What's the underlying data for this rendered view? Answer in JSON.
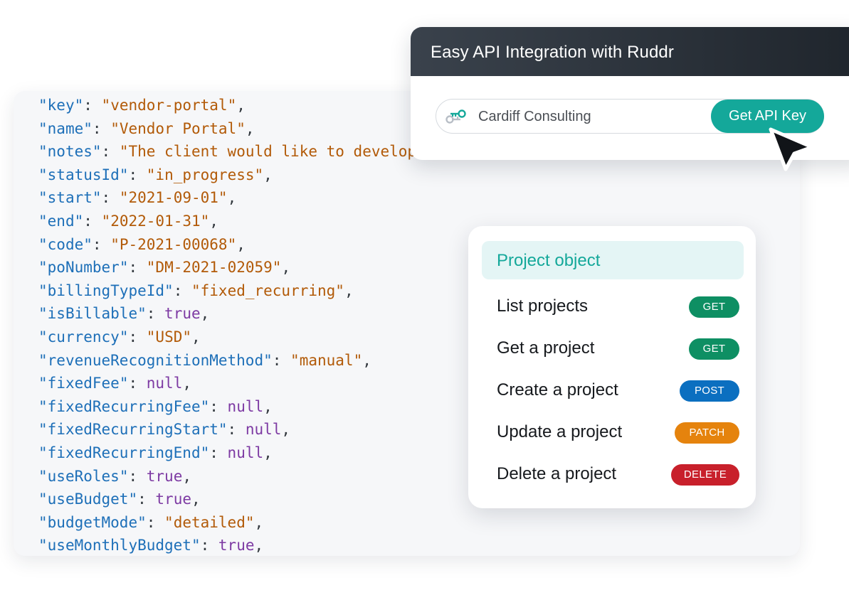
{
  "code": {
    "lines": [
      {
        "key": "key",
        "value": "vendor-portal",
        "type": "string"
      },
      {
        "key": "name",
        "value": "Vendor Portal",
        "type": "string"
      },
      {
        "key": "notes",
        "value": "The client would like to develop",
        "type": "string-open"
      },
      {
        "key": "statusId",
        "value": "in_progress",
        "type": "string"
      },
      {
        "key": "start",
        "value": "2021-09-01",
        "type": "string"
      },
      {
        "key": "end",
        "value": "2022-01-31",
        "type": "string"
      },
      {
        "key": "code",
        "value": "P-2021-00068",
        "type": "string"
      },
      {
        "key": "poNumber",
        "value": "DM-2021-02059",
        "type": "string"
      },
      {
        "key": "billingTypeId",
        "value": "fixed_recurring",
        "type": "string"
      },
      {
        "key": "isBillable",
        "value": "true",
        "type": "literal"
      },
      {
        "key": "currency",
        "value": "USD",
        "type": "string"
      },
      {
        "key": "revenueRecognitionMethod",
        "value": "manual",
        "type": "string"
      },
      {
        "key": "fixedFee",
        "value": "null",
        "type": "literal"
      },
      {
        "key": "fixedRecurringFee",
        "value": "null",
        "type": "literal"
      },
      {
        "key": "fixedRecurringStart",
        "value": "null",
        "type": "literal"
      },
      {
        "key": "fixedRecurringEnd",
        "value": "null",
        "type": "literal"
      },
      {
        "key": "useRoles",
        "value": "true",
        "type": "literal"
      },
      {
        "key": "useBudget",
        "value": "true",
        "type": "literal"
      },
      {
        "key": "budgetMode",
        "value": "detailed",
        "type": "string"
      },
      {
        "key": "useMonthlyBudget",
        "value": "true",
        "type": "literal"
      }
    ]
  },
  "api_card": {
    "title": "Easy API Integration with Ruddr",
    "input_value": "Cardiff Consulting",
    "key_icon": "key-icon",
    "button_label": "Get API Key"
  },
  "cursor_icon": "arrow-cursor-icon",
  "endpoints": {
    "title": "Project object",
    "items": [
      {
        "label": "List projects",
        "method": "GET",
        "color": "#0e8f63"
      },
      {
        "label": "Get a project",
        "method": "GET",
        "color": "#0e8f63"
      },
      {
        "label": "Create a project",
        "method": "POST",
        "color": "#0b6fc0"
      },
      {
        "label": "Update a project",
        "method": "PATCH",
        "color": "#e5830d"
      },
      {
        "label": "Delete a project",
        "method": "DELETE",
        "color": "#c8202b"
      }
    ]
  },
  "colors": {
    "accent": "#14a89a",
    "code_key": "#1d6fb8",
    "code_string": "#b25a08",
    "code_literal": "#7d3aa3"
  }
}
